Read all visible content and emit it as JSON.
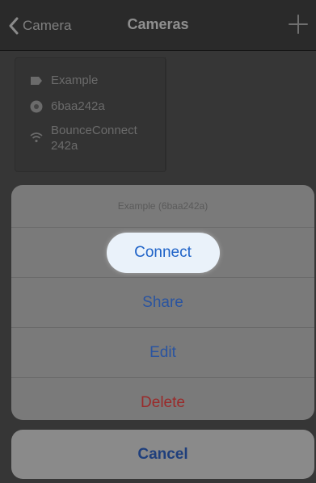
{
  "navbar": {
    "back_label": "Camera",
    "title": "Cameras",
    "add_icon": "plus-icon"
  },
  "camera_card": {
    "name": "Example",
    "name_icon": "tag-icon",
    "id": "6baa242a",
    "id_icon": "camera-lens-icon",
    "network": "BounceConnect\n242a",
    "network_icon": "wifi-icon"
  },
  "action_sheet": {
    "title": "Example (6baa242a)",
    "connect_label": "Connect",
    "share_label": "Share",
    "edit_label": "Edit",
    "delete_label": "Delete",
    "cancel_label": "Cancel"
  },
  "colors": {
    "action_blue": "#2a54a0",
    "destructive_red": "#9a2a2a",
    "highlight_pill": "#eaf2fa"
  }
}
